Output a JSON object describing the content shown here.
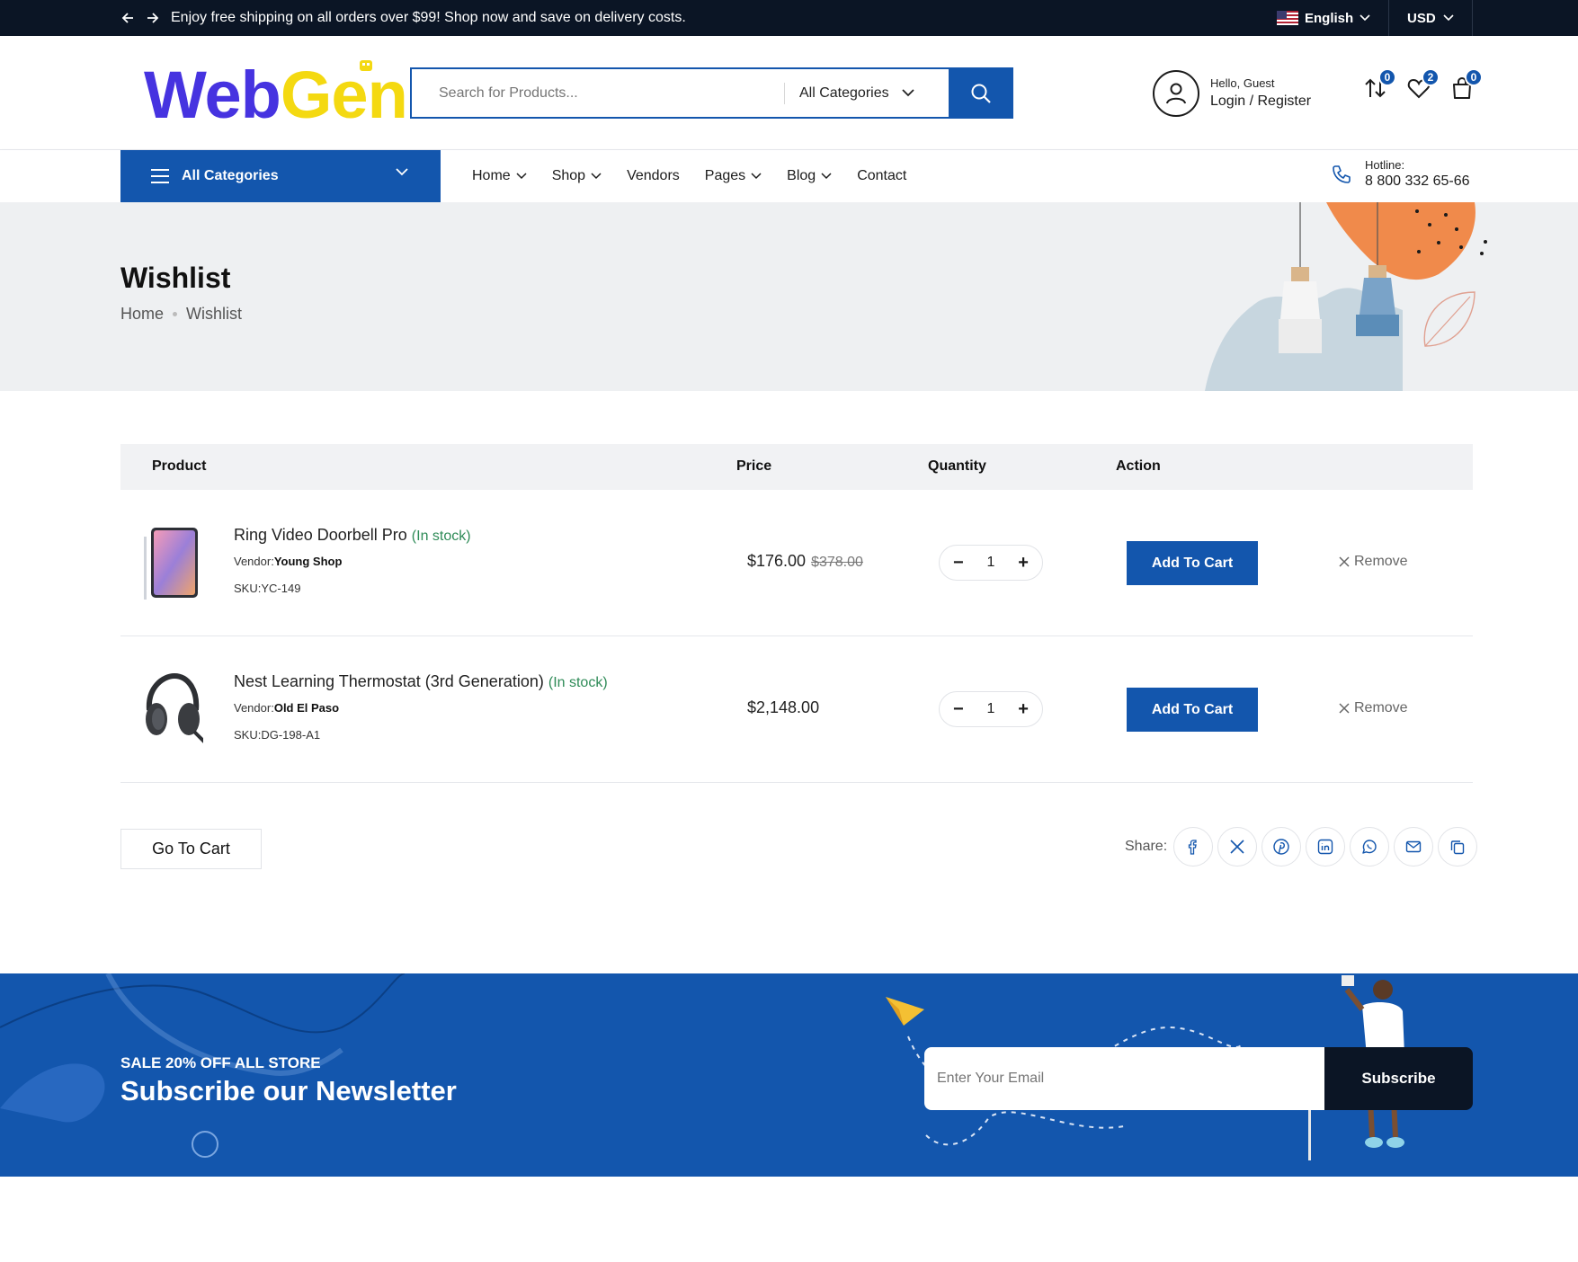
{
  "topbar": {
    "promo": "Enjoy free shipping on all orders over $99! Shop now and save on delivery costs.",
    "language": "English",
    "currency": "USD"
  },
  "header": {
    "logo_part1": "Web",
    "logo_part2": "Gen",
    "search_placeholder": "Search for Products...",
    "search_category": "All Categories",
    "greeting": "Hello, Guest",
    "login_label": "Login / Register",
    "compare_count": "0",
    "wishlist_count": "2",
    "cart_count": "0"
  },
  "nav": {
    "all_categories": "All Categories",
    "items": [
      "Home",
      "Shop",
      "Vendors",
      "Pages",
      "Blog",
      "Contact"
    ],
    "hotline_label": "Hotline:",
    "hotline_number": "8 800 332 65-66"
  },
  "banner": {
    "title": "Wishlist",
    "breadcrumb": [
      "Home",
      "Wishlist"
    ]
  },
  "table": {
    "headers": [
      "Product",
      "Price",
      "Quantity",
      "Action"
    ],
    "rows": [
      {
        "name": "Ring Video Doorbell Pro",
        "stock": "In stock",
        "vendor_label": "Vendor:",
        "vendor": "Young Shop",
        "sku": "SKU:YC-149",
        "price": "$176.00",
        "old_price": "$378.00",
        "qty": "1",
        "add_label": "Add To Cart",
        "remove_label": "Remove"
      },
      {
        "name": "Nest Learning Thermostat (3rd Generation)",
        "stock": "In stock",
        "vendor_label": "Vendor:",
        "vendor": "Old El Paso",
        "sku": "SKU:DG-198-A1",
        "price": "$2,148.00",
        "old_price": "",
        "qty": "1",
        "add_label": "Add To Cart",
        "remove_label": "Remove"
      }
    ]
  },
  "actions": {
    "go_to_cart": "Go To Cart",
    "share_label": "Share:"
  },
  "newsletter": {
    "sale": "SALE 20% OFF ALL STORE",
    "title": "Subscribe our Newsletter",
    "email_placeholder": "Enter Your Email",
    "subscribe_label": "Subscribe"
  },
  "colors": {
    "primary": "#1356ad",
    "dark": "#0b1525",
    "stock": "#2e8b57"
  }
}
